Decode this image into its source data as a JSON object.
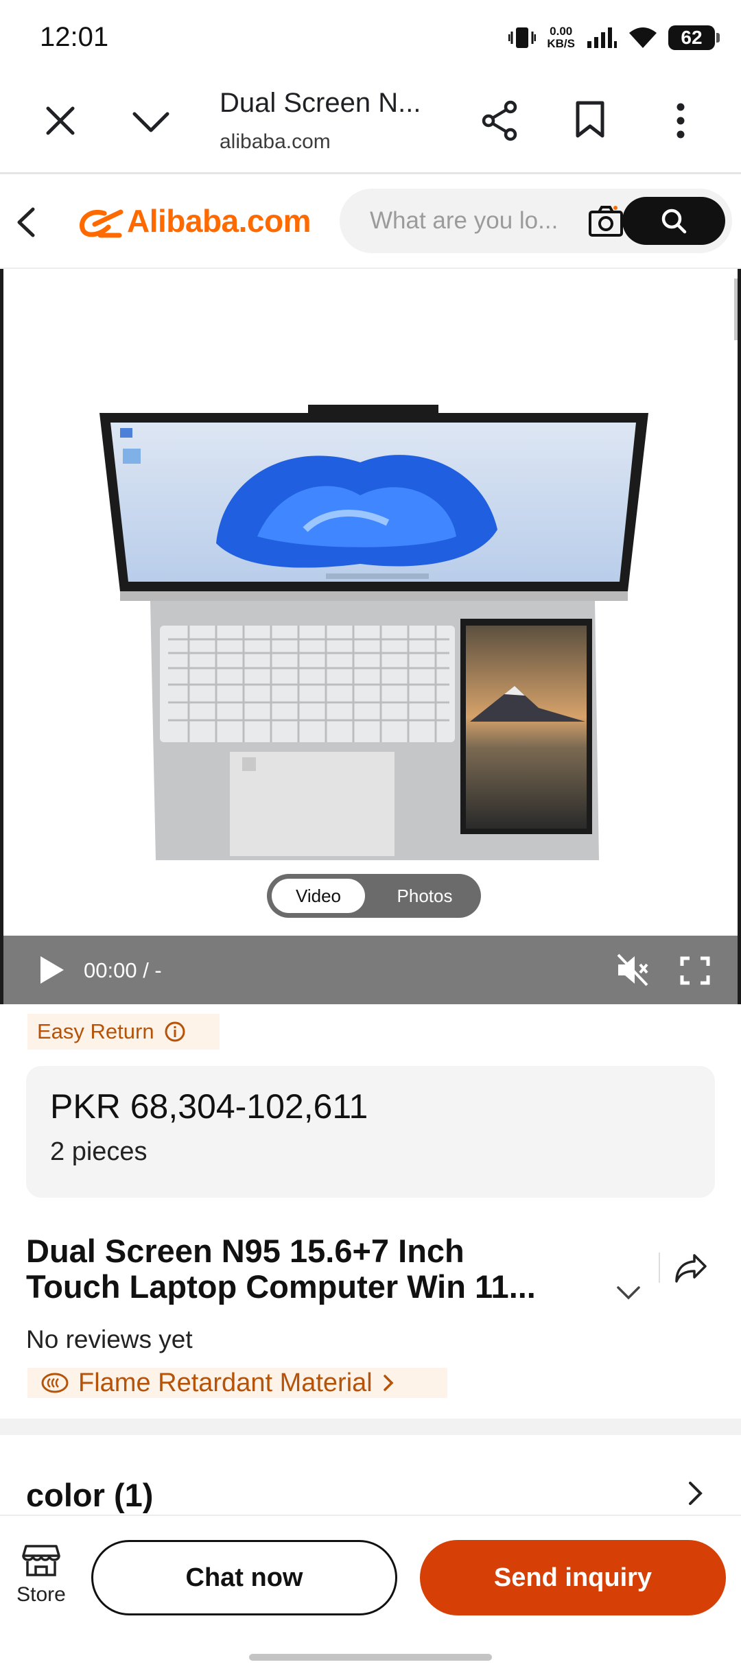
{
  "status_bar": {
    "time": "12:01",
    "net_speed_value": "0.00",
    "net_speed_unit": "KB/S",
    "battery": "62"
  },
  "browser": {
    "page_title": "Dual Screen N...",
    "domain": "alibaba.com"
  },
  "header": {
    "logo": "Alibaba.com",
    "search_placeholder": "What are you lo..."
  },
  "media": {
    "toggle_video": "Video",
    "toggle_photos": "Photos",
    "video_time": "00:00 / -"
  },
  "product": {
    "easy_return": "Easy Return",
    "price": "PKR 68,304-102,611",
    "moq": "2 pieces",
    "title_line1": "Dual Screen N95 15.6+7 Inch",
    "title_line2": "Touch Laptop Computer Win 11...",
    "reviews": "No reviews yet",
    "feature": "Flame Retardant Material",
    "color_label": "color (1)"
  },
  "bottom": {
    "store": "Store",
    "chat": "Chat now",
    "inquiry": "Send inquiry"
  },
  "colors": {
    "brand_orange": "#ff6a00",
    "inquiry_button": "#d63f05",
    "tag_text": "#b45309",
    "tag_bg": "#fdf3e8"
  }
}
